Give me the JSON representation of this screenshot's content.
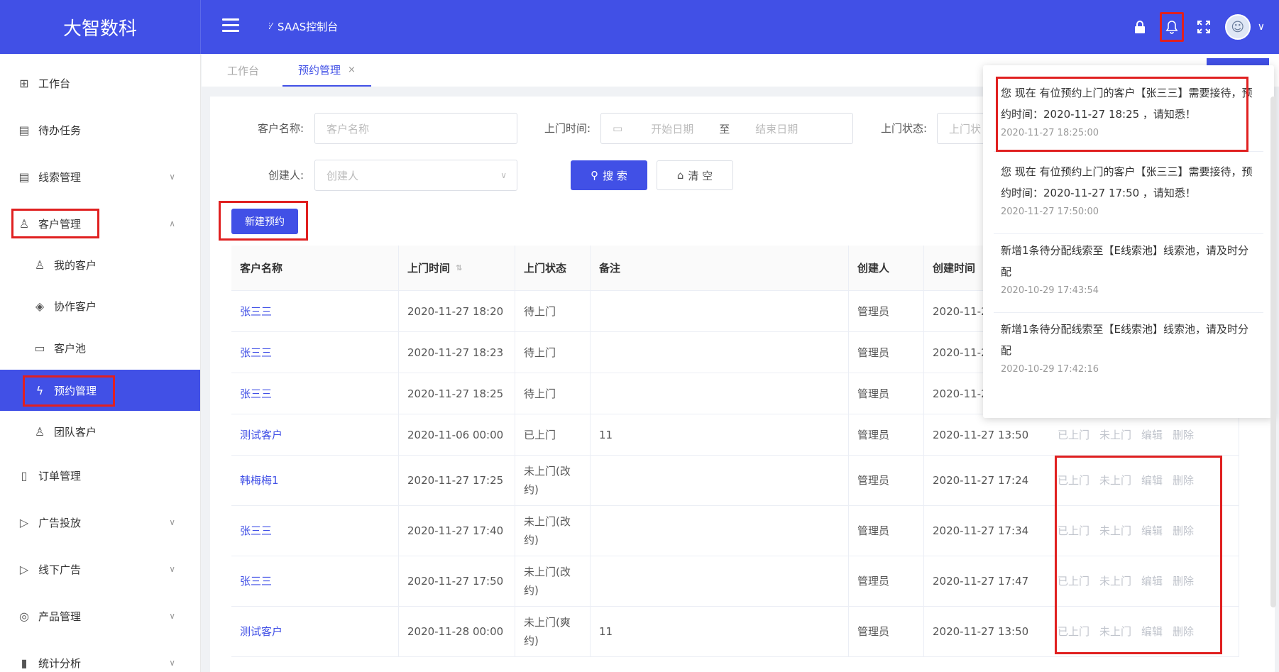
{
  "header": {
    "brand": "大智数科",
    "console_title": "SAAS控制台",
    "icons": [
      "lock-icon",
      "bell-icon",
      "fullscreen-icon",
      "avatar",
      "chevron-down-icon"
    ],
    "accent_color": "#4150e6"
  },
  "sidebar": {
    "items": [
      {
        "label": "工作台",
        "icon": "dashboard-icon"
      },
      {
        "label": "待办任务",
        "icon": "task-icon"
      },
      {
        "label": "线索管理",
        "icon": "clue-icon",
        "caret": "down"
      },
      {
        "label": "客户管理",
        "icon": "customer-icon",
        "caret": "up"
      },
      {
        "label": "我的客户",
        "icon": "user-icon"
      },
      {
        "label": "协作客户",
        "icon": "collab-icon"
      },
      {
        "label": "客户池",
        "icon": "pool-icon"
      },
      {
        "label": "预约管理",
        "icon": "appointment-icon",
        "active": true
      },
      {
        "label": "团队客户",
        "icon": "team-icon"
      },
      {
        "label": "订单管理",
        "icon": "order-icon"
      },
      {
        "label": "广告投放",
        "icon": "ad-icon",
        "caret": "down"
      },
      {
        "label": "线下广告",
        "icon": "offline-ad-icon",
        "caret": "down"
      },
      {
        "label": "产品管理",
        "icon": "product-icon",
        "caret": "down"
      },
      {
        "label": "统计分析",
        "icon": "stats-icon",
        "caret": "down"
      }
    ]
  },
  "tabs": [
    {
      "label": "工作台"
    },
    {
      "label": "预约管理",
      "active": true,
      "close": "×"
    }
  ],
  "search": {
    "customer_name_label": "客户名称:",
    "customer_name_placeholder": "客户名称",
    "visit_time_label": "上门时间:",
    "start_date_placeholder": "开始日期",
    "date_separator": "至",
    "end_date_placeholder": "结束日期",
    "visit_status_label": "上门状态:",
    "visit_status_placeholder": "上门状",
    "creator_label": "创建人:",
    "creator_placeholder": "创建人",
    "search_button": "搜 索",
    "clear_button": "清 空",
    "new_button": "新建预约"
  },
  "table": {
    "columns": [
      "客户名称",
      "上门时间",
      "上门状态",
      "备注",
      "创建人",
      "创建时间"
    ],
    "rows": [
      {
        "name": "张三三",
        "visit_time": "2020-11-27 18:20",
        "status": "待上门",
        "note": "",
        "creator": "管理员",
        "created": "2020-11-2"
      },
      {
        "name": "张三三",
        "visit_time": "2020-11-27 18:23",
        "status": "待上门",
        "note": "",
        "creator": "管理员",
        "created": "2020-11-2"
      },
      {
        "name": "张三三",
        "visit_time": "2020-11-27 18:25",
        "status": "待上门",
        "note": "",
        "creator": "管理员",
        "created": "2020-11-2"
      },
      {
        "name": "测试客户",
        "visit_time": "2020-11-06 00:00",
        "status": "已上门",
        "note": "11",
        "creator": "管理员",
        "created": "2020-11-27 13:50"
      },
      {
        "name": "韩梅梅1",
        "visit_time": "2020-11-27 17:25",
        "status": "未上门(改约)",
        "note": "",
        "creator": "管理员",
        "created": "2020-11-27 17:24"
      },
      {
        "name": "张三三",
        "visit_time": "2020-11-27 17:40",
        "status": "未上门(改约)",
        "note": "",
        "creator": "管理员",
        "created": "2020-11-27 17:34"
      },
      {
        "name": "张三三",
        "visit_time": "2020-11-27 17:50",
        "status": "未上门(改约)",
        "note": "",
        "creator": "管理员",
        "created": "2020-11-27 17:47"
      },
      {
        "name": "测试客户",
        "visit_time": "2020-11-28 00:00",
        "status": "未上门(爽约)",
        "note": "11",
        "creator": "管理员",
        "created": "2020-11-27 13:50"
      }
    ],
    "ops": [
      "已上门",
      "未上门",
      "编辑",
      "删除"
    ]
  },
  "notifications": [
    {
      "text": "您 现在 有位预约上门的客户【张三三】需要接待，预约时间：2020-11-27 18:25 ，请知悉！",
      "time": "2020-11-27 18:25:00"
    },
    {
      "text": "您 现在 有位预约上门的客户【张三三】需要接待，预约时间：2020-11-27 17:50 ，请知悉！",
      "time": "2020-11-27 17:50:00"
    },
    {
      "text": "新增1条待分配线索至【E线索池】线索池，请及时分配",
      "time": "2020-10-29 17:43:54"
    },
    {
      "text": "新增1条待分配线索至【E线索池】线索池，请及时分配",
      "time": "2020-10-29 17:42:16"
    }
  ]
}
